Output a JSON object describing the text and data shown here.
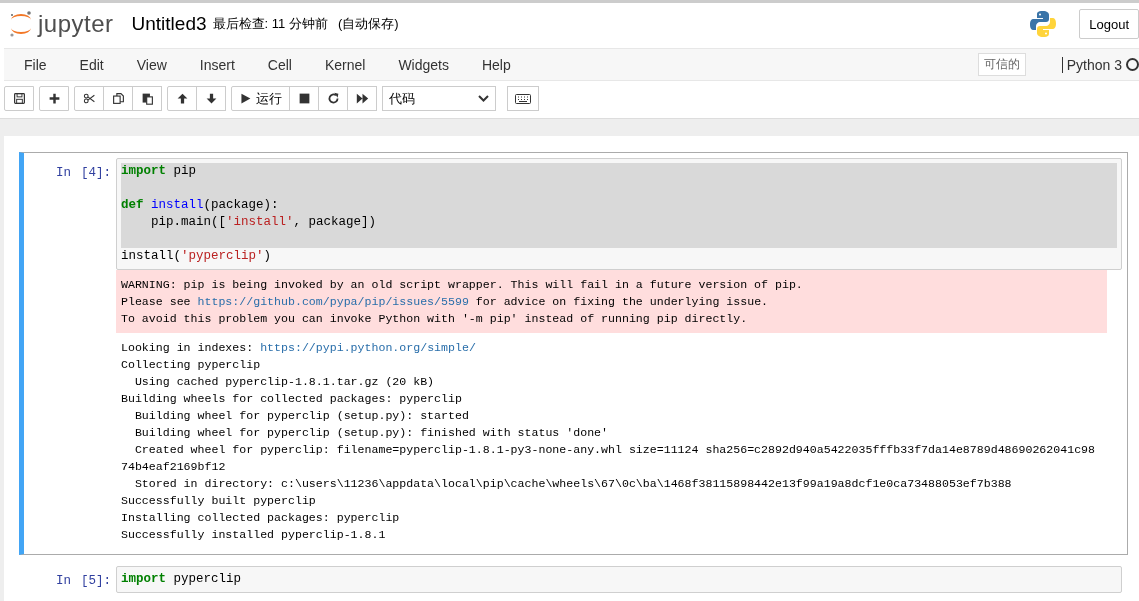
{
  "header": {
    "logo_text": "jupyter",
    "notebook_name": "Untitled3",
    "checkpoint": "最后检查: 11 分钟前",
    "autosave": "(自动保存)",
    "logout": "Logout"
  },
  "menubar": {
    "items": [
      "File",
      "Edit",
      "View",
      "Insert",
      "Cell",
      "Kernel",
      "Widgets",
      "Help"
    ],
    "trusted": "可信的",
    "kernel_name": "Python 3",
    "kernel_busy": false
  },
  "toolbar": {
    "groups": [
      [
        {
          "kind": "save"
        }
      ],
      [
        {
          "kind": "insert"
        }
      ],
      [
        {
          "kind": "cut"
        },
        {
          "kind": "copy"
        },
        {
          "kind": "paste"
        }
      ],
      [
        {
          "kind": "up"
        },
        {
          "kind": "down"
        }
      ],
      [
        {
          "kind": "run"
        },
        {
          "kind": "stop"
        },
        {
          "kind": "restart"
        },
        {
          "kind": "fastforward"
        }
      ]
    ],
    "run_label": "运行",
    "cell_type": "代码",
    "extra": [
      {
        "kind": "keyboard"
      }
    ]
  },
  "cells": [
    {
      "prompt": "In",
      "count": "[4]:",
      "selected": true,
      "code": [
        {
          "kind": "block",
          "tokens": [
            {
              "kind": "keyword",
              "text": "import"
            },
            {
              "kind": "plain",
              "text": " pip"
            }
          ]
        },
        {
          "kind": "block"
        },
        {
          "kind": "block",
          "tokens": [
            {
              "kind": "keyword",
              "text": "def "
            },
            {
              "kind": "defname",
              "text": "install"
            },
            {
              "kind": "plain",
              "text": "(package):"
            }
          ]
        },
        {
          "kind": "block",
          "tokens": [
            {
              "kind": "plain",
              "text": "    pip.main(["
            },
            {
              "kind": "string",
              "text": "'install'"
            },
            {
              "kind": "plain",
              "text": ", package])"
            }
          ]
        },
        {
          "kind": "block"
        },
        {
          "kind": "inline",
          "tokens": [
            {
              "kind": "plain",
              "text": "install("
            },
            {
              "kind": "string",
              "text": "'pyperclip'"
            },
            {
              "kind": "plain",
              "text": ")"
            }
          ]
        }
      ],
      "outputs": [
        {
          "kind": "stderr",
          "lines": [
            [
              {
                "kind": "plain",
                "text": "WARNING: pip is being invoked by an old script wrapper. This will fail in a future version of pip."
              }
            ],
            [
              {
                "kind": "plain",
                "text": "Please see "
              },
              {
                "kind": "link",
                "text": "https://github.com/pypa/pip/issues/5599"
              },
              {
                "kind": "plain",
                "text": " for advice on fixing the underlying issue."
              }
            ],
            [
              {
                "kind": "plain",
                "text": "To avoid this problem you can invoke Python with '-m pip' instead of running pip directly."
              }
            ]
          ]
        },
        {
          "kind": "stdout",
          "lines": [
            [
              {
                "kind": "plain",
                "text": "Looking in indexes: "
              },
              {
                "kind": "link",
                "text": "https://pypi.python.org/simple/"
              }
            ],
            [
              {
                "kind": "plain",
                "text": "Collecting pyperclip"
              }
            ],
            [
              {
                "kind": "plain",
                "text": "  Using cached pyperclip-1.8.1.tar.gz (20 kB)"
              }
            ],
            [
              {
                "kind": "plain",
                "text": "Building wheels for collected packages: pyperclip"
              }
            ],
            [
              {
                "kind": "plain",
                "text": "  Building wheel for pyperclip (setup.py): started"
              }
            ],
            [
              {
                "kind": "plain",
                "text": "  Building wheel for pyperclip (setup.py): finished with status 'done'"
              }
            ],
            [
              {
                "kind": "plain",
                "text": "  Created wheel for pyperclip: filename=pyperclip-1.8.1-py3-none-any.whl size=11124 sha256=c2892d940a5422035fffb33f7da14e8789d48690262041c98"
              }
            ],
            [
              {
                "kind": "plain",
                "text": "74b4eaf2169bf12"
              }
            ],
            [
              {
                "kind": "plain",
                "text": "  Stored in directory: c:\\users\\11236\\appdata\\local\\pip\\cache\\wheels\\67\\0c\\ba\\1468f38115898442e13f99a19a8dcf1e0ca73488053ef7b388"
              }
            ],
            [
              {
                "kind": "plain",
                "text": "Successfully built pyperclip"
              }
            ],
            [
              {
                "kind": "plain",
                "text": "Installing collected packages: pyperclip"
              }
            ],
            [
              {
                "kind": "plain",
                "text": "Successfully installed pyperclip-1.8.1"
              }
            ]
          ]
        }
      ]
    },
    {
      "prompt": "In",
      "count": "[5]:",
      "selected": false,
      "code": [
        {
          "kind": "plain",
          "tokens": [
            {
              "kind": "keyword",
              "text": "import"
            },
            {
              "kind": "plain",
              "text": " pyperclip"
            }
          ]
        }
      ]
    }
  ]
}
